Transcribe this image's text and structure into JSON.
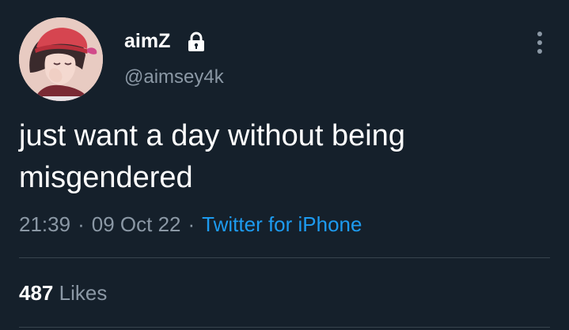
{
  "tweet": {
    "author": {
      "display_name": "aimZ",
      "handle": "@aimsey4k",
      "protected_icon": "lock-icon",
      "avatar_icon": "avatar-illustration"
    },
    "menu_icon": "more-vertical-icon",
    "text": "just want a day without being misgendered",
    "meta": {
      "time": "21:39",
      "separator_1": "·",
      "date": "09 Oct 22",
      "separator_2": "·",
      "source": "Twitter for iPhone"
    },
    "stats": {
      "likes_count": "487",
      "likes_label": "Likes"
    }
  },
  "colors": {
    "background": "#15202b",
    "primary_text": "#ffffff",
    "secondary_text": "#8b98a5",
    "link": "#1d9bf0",
    "divider": "#38444d"
  }
}
